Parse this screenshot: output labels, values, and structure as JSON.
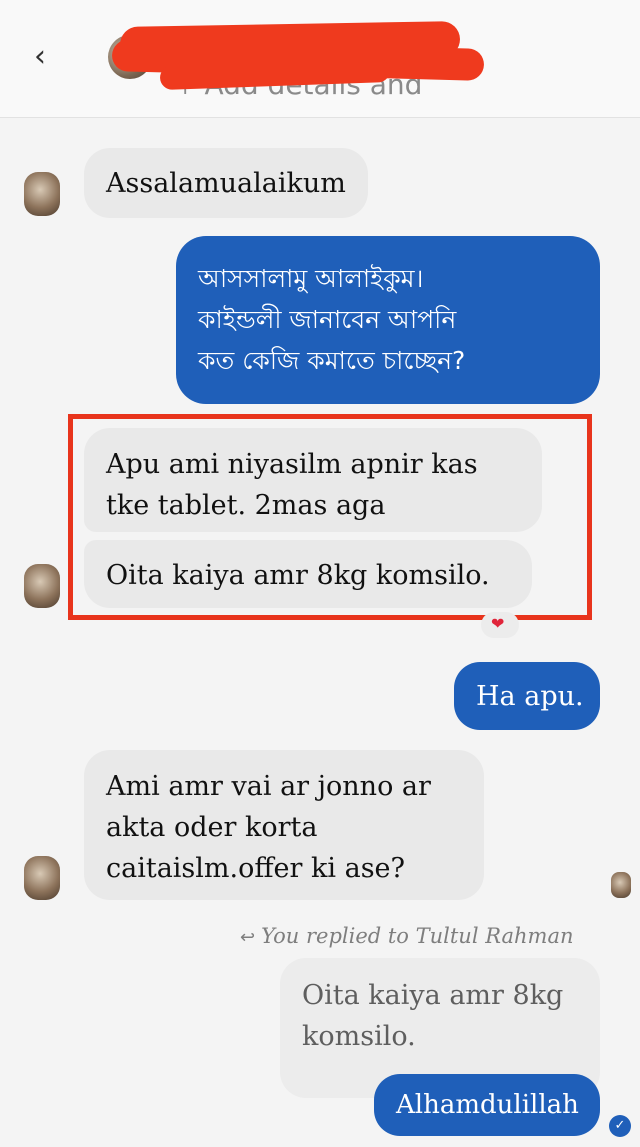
{
  "header": {
    "back_icon": "chevron-left-icon",
    "subtitle": "Add details and",
    "subtitle_prefix": "+",
    "name_redacted": true
  },
  "messages": [
    {
      "side": "incoming",
      "lines": [
        "Assalamualaikum"
      ]
    },
    {
      "side": "outgoing",
      "lines": [
        "আসসালামু আলাইকুম।",
        "কাইন্ডলী জানাবেন আপনি",
        "কত কেজি কমাতে চাচ্ছেন?"
      ]
    },
    {
      "side": "incoming",
      "lines": [
        "Apu ami niyasilm apnir kas",
        "tke tablet. 2mas aga"
      ]
    },
    {
      "side": "incoming",
      "lines": [
        "Oita kaiya amr 8kg komsilo."
      ],
      "reaction": "heart-icon"
    },
    {
      "side": "outgoing",
      "lines": [
        "Ha apu."
      ]
    },
    {
      "side": "incoming",
      "lines": [
        "Ami amr vai ar jonno ar",
        "akta oder korta",
        "caitaislm.offer ki ase?"
      ]
    }
  ],
  "reply": {
    "note": "You replied to Tultul Rahman",
    "quoted_lines": [
      "Oita kaiya amr 8kg",
      "komsilo."
    ],
    "message": "Alhamdulillah"
  },
  "colors": {
    "outgoing_bubble": "#1f5fb9",
    "incoming_bubble": "#e9e9e9",
    "highlight_border": "#e8341c",
    "redaction": "#ef3a1e"
  }
}
